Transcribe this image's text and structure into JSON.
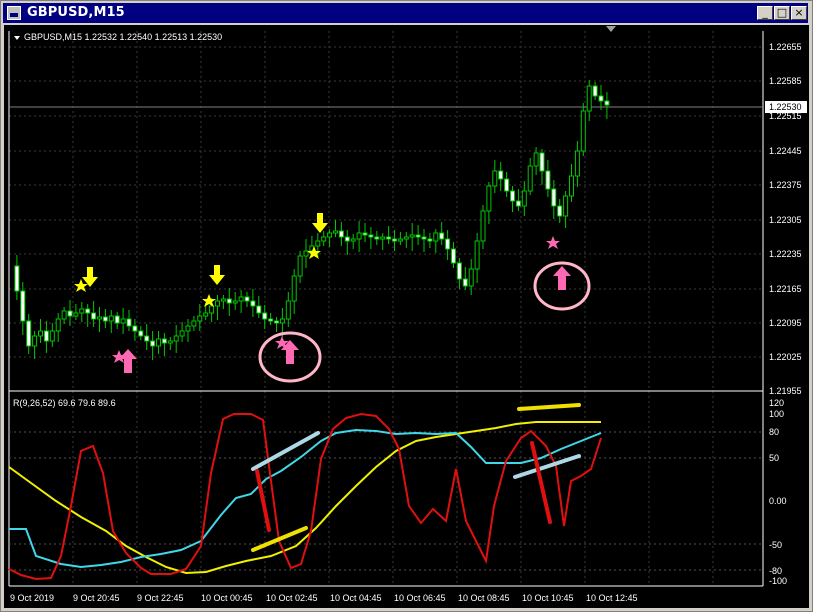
{
  "window": {
    "title": "GBPUSD,M15",
    "buttons": {
      "minimize": "_",
      "maximize": "□",
      "close": "×"
    }
  },
  "main_chart": {
    "header": "GBPUSD,M15  1.22532 1.22540 1.22513 1.22530",
    "price_labels": [
      "1.22655",
      "1.22585",
      "1.22515",
      "1.22445",
      "1.22375",
      "1.22305",
      "1.22235",
      "1.22165",
      "1.22095",
      "1.22025",
      "1.21955"
    ],
    "current_price": "1.22530"
  },
  "indicator": {
    "header": "R(9,26,52) 69.6 79.6 89.6",
    "scale_labels": [
      "120",
      "100",
      "80",
      "50",
      "0.00",
      "-50",
      "-80",
      "-100"
    ]
  },
  "time_axis": [
    "9 Oct 2019",
    "9 Oct 20:45",
    "9 Oct 22:45",
    "10 Oct 00:45",
    "10 Oct 02:45",
    "10 Oct 04:45",
    "10 Oct 06:45",
    "10 Oct 08:45",
    "10 Oct 10:45",
    "10 Oct 12:45"
  ],
  "colors": {
    "background": "#000000",
    "candle": "#00c800",
    "arrow_down": "#ffff00",
    "arrow_up": "#ff69b4",
    "star_yellow": "#ffff00",
    "star_pink": "#ff69b4",
    "line_red": "#e01010",
    "line_cyan": "#40d8e8",
    "line_yellow": "#f0f000"
  }
}
